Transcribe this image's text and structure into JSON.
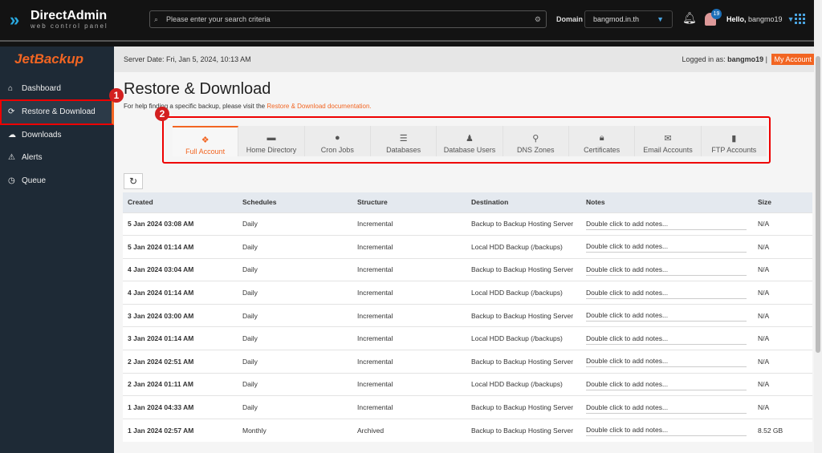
{
  "topbar": {
    "brand": "DirectAdmin",
    "tagline": "web control panel",
    "search_placeholder": "Please enter your search criteria",
    "domain_label": "Domain",
    "domain_value": "bangmod.in.th",
    "notif_count": "19",
    "hello": "Hello,",
    "user": "bangmo19"
  },
  "sidebar": {
    "brand": "JetBackup",
    "items": [
      {
        "label": "Dashboard",
        "icon": "home-icon"
      },
      {
        "label": "Restore & Download",
        "icon": "refresh-icon",
        "active": true
      },
      {
        "label": "Downloads",
        "icon": "cloud-download-icon"
      },
      {
        "label": "Alerts",
        "icon": "warning-icon"
      },
      {
        "label": "Queue",
        "icon": "clock-icon"
      }
    ]
  },
  "header": {
    "server_date": "Server Date: Fri, Jan 5, 2024, 10:13 AM",
    "logged_in": "Logged in as:",
    "user": "bangmo19",
    "my_account": "My Account"
  },
  "page": {
    "title": "Restore & Download",
    "help_prefix": "For help finding a specific backup, please visit the",
    "help_link": "Restore & Download documentation."
  },
  "markers": [
    "1",
    "2"
  ],
  "tabs": [
    {
      "label": "Full Account",
      "active": true
    },
    {
      "label": "Home Directory"
    },
    {
      "label": "Cron Jobs"
    },
    {
      "label": "Databases"
    },
    {
      "label": "Database Users"
    },
    {
      "label": "DNS Zones"
    },
    {
      "label": "Certificates"
    },
    {
      "label": "Email Accounts"
    },
    {
      "label": "FTP Accounts"
    }
  ],
  "table": {
    "columns": [
      "Created",
      "Schedules",
      "Structure",
      "Destination",
      "Notes",
      "Size"
    ],
    "rows": [
      [
        "5 Jan 2024 03:08 AM",
        "Daily",
        "Incremental",
        "Backup to Backup Hosting Server",
        "Double click to add notes...",
        "N/A"
      ],
      [
        "5 Jan 2024 01:14 AM",
        "Daily",
        "Incremental",
        "Local HDD Backup (/backups)",
        "Double click to add notes...",
        "N/A"
      ],
      [
        "4 Jan 2024 03:04 AM",
        "Daily",
        "Incremental",
        "Backup to Backup Hosting Server",
        "Double click to add notes...",
        "N/A"
      ],
      [
        "4 Jan 2024 01:14 AM",
        "Daily",
        "Incremental",
        "Local HDD Backup (/backups)",
        "Double click to add notes...",
        "N/A"
      ],
      [
        "3 Jan 2024 03:00 AM",
        "Daily",
        "Incremental",
        "Backup to Backup Hosting Server",
        "Double click to add notes...",
        "N/A"
      ],
      [
        "3 Jan 2024 01:14 AM",
        "Daily",
        "Incremental",
        "Local HDD Backup (/backups)",
        "Double click to add notes...",
        "N/A"
      ],
      [
        "2 Jan 2024 02:51 AM",
        "Daily",
        "Incremental",
        "Backup to Backup Hosting Server",
        "Double click to add notes...",
        "N/A"
      ],
      [
        "2 Jan 2024 01:11 AM",
        "Daily",
        "Incremental",
        "Local HDD Backup (/backups)",
        "Double click to add notes...",
        "N/A"
      ],
      [
        "1 Jan 2024 04:33 AM",
        "Daily",
        "Incremental",
        "Backup to Backup Hosting Server",
        "Double click to add notes...",
        "N/A"
      ],
      [
        "1 Jan 2024 02:57 AM",
        "Monthly",
        "Archived",
        "Backup to Backup Hosting Server",
        "Double click to add notes...",
        "8.52 GB"
      ]
    ]
  },
  "colors": {
    "accent": "#f26522",
    "highlight": "#e00000",
    "sidebar": "#1e2a36"
  }
}
